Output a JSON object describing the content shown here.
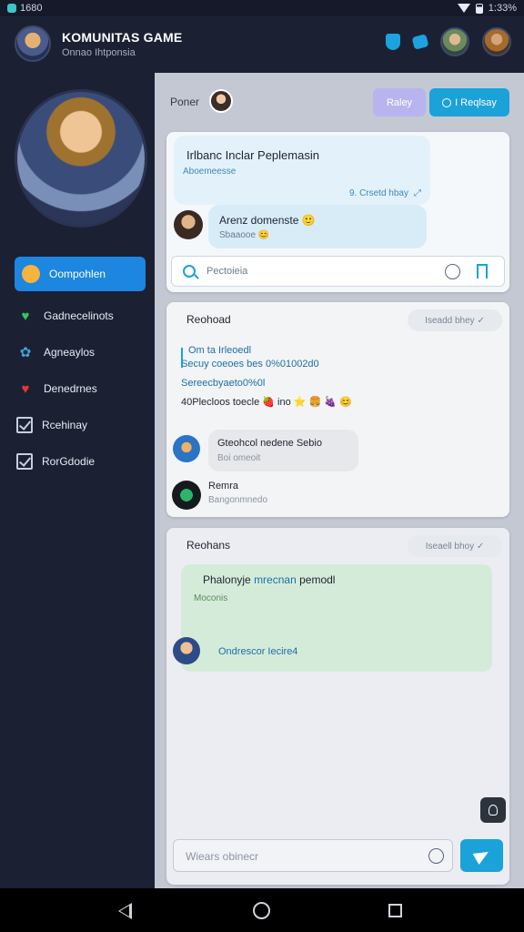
{
  "status": {
    "left_text": "1680",
    "right_text": "1:33%"
  },
  "header": {
    "title": "KOMUNITAS GAME",
    "subtitle": "Onnao Ihtponsia"
  },
  "sidebar": {
    "items": [
      {
        "label": "Oompohlen",
        "icon": "face-icon",
        "active": true
      },
      {
        "label": "Gadnecelinots",
        "icon": "heart-green-icon"
      },
      {
        "label": "Agneaylos",
        "icon": "flower-icon"
      },
      {
        "label": "Denedrnes",
        "icon": "heart-icon"
      },
      {
        "label": "Rcehinay",
        "icon": "checkbox-icon"
      },
      {
        "label": "RorGdodie",
        "icon": "checkbox-icon"
      }
    ]
  },
  "topbar": {
    "label": "Poner",
    "btn_ghost": "Raley",
    "btn_primary": "I Reqlsay"
  },
  "card1": {
    "title": "Irlbanc Inclar Peplemasin",
    "subtitle": "Aboemeesse",
    "meta": "9. Crsetd hbay",
    "message": "Arenz domenste 🙂",
    "message_sub": "Sbaaooe 😊",
    "search_placeholder": "Pectoieia"
  },
  "card2": {
    "heading": "Reohoad",
    "tag": "Iseadd bhey ✓",
    "lines": [
      "Om ta Irleoedl",
      "Secuy coeoes bes 0%01002d0",
      "Sereecbyaeto0%0l"
    ],
    "line_emoji": "40Plecloos toecle 🍓 ino ⭐ 🍔 🍇 😊",
    "message": "Gteohcol nedene Sebio",
    "message_sub": "Boi omeoit",
    "user_name": "Remra",
    "user_role": "Bangonmnedo"
  },
  "card3": {
    "heading": "Reohans",
    "tag": "Iseaell bhoy ✓",
    "post_title_a": "Phalonyje",
    "post_title_b": "mrecnan",
    "post_title_c": "pemodl",
    "post_sub": "Moconis",
    "message": "Ondrescor Iecire4",
    "composer_placeholder": "Wiears obinecr"
  },
  "colors": {
    "accent": "#1ba2d8",
    "sidebar_bg": "#1b2033",
    "active_item": "#1c86e0"
  }
}
